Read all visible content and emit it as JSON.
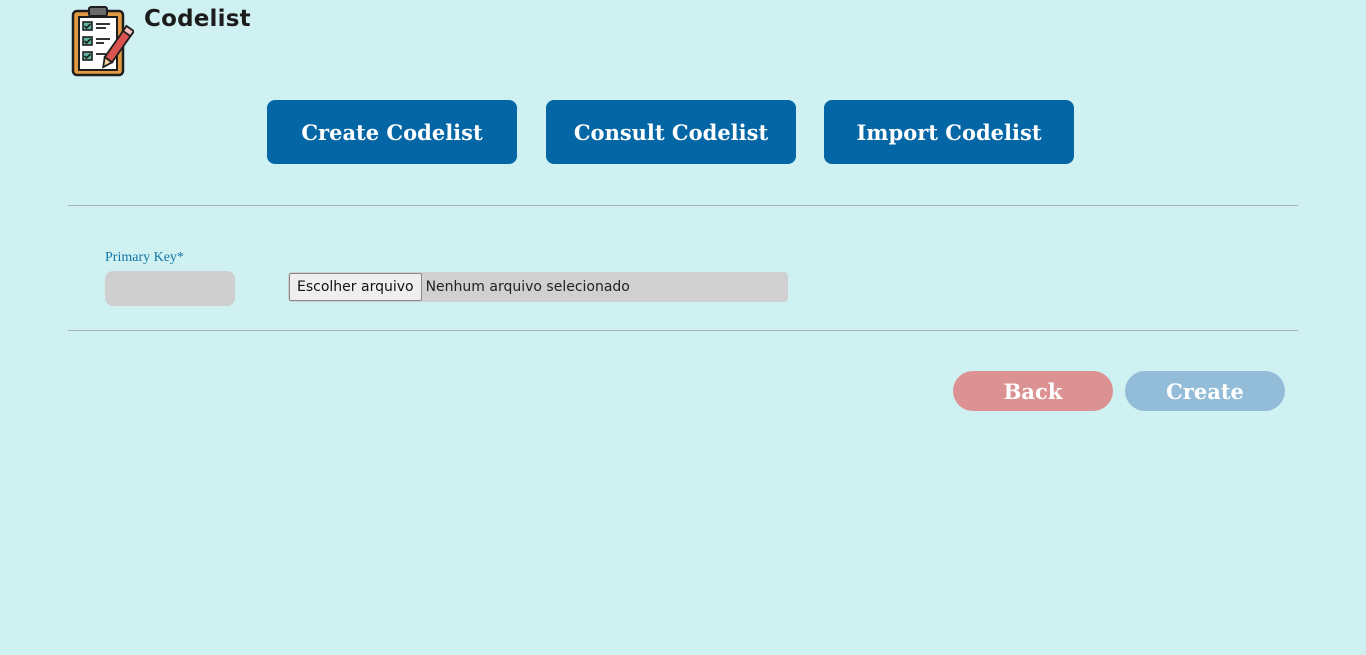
{
  "app": {
    "title": "Codelist",
    "logo_icon": "clipboard-checklist-icon"
  },
  "nav": {
    "create_label": "Create Codelist",
    "consult_label": "Consult Codelist",
    "import_label": "Import Codelist",
    "button_color": "#0566a6"
  },
  "form": {
    "primary_key_label": "Primary Key*",
    "primary_key_value": "",
    "file_button_label": "Escolher arquivo",
    "file_status": "Nenhum arquivo selecionado"
  },
  "actions": {
    "back_label": "Back",
    "create_label": "Create",
    "back_color": "#dc9192",
    "create_color": "#93bcd9"
  },
  "colors": {
    "background": "#d0f1f2"
  }
}
